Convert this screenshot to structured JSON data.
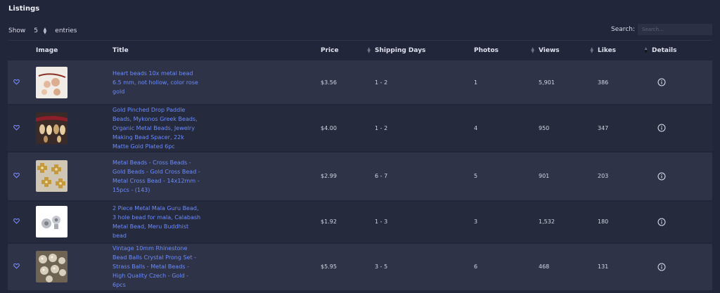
{
  "header": {
    "title": "Listings"
  },
  "length_control": {
    "show_label": "Show",
    "value": "5",
    "entries_label": "entries"
  },
  "search": {
    "label": "Search:",
    "placeholder": "Search..."
  },
  "columns": {
    "image": "Image",
    "title": "Title",
    "price": "Price",
    "shipping": "Shipping Days",
    "photos": "Photos",
    "views": "Views",
    "likes": "Likes",
    "details": "Details"
  },
  "rows": [
    {
      "title": "Heart beads 10x metal bead 6.5 mm, not hollow, color rose gold",
      "price": "$3.56",
      "shipping": "1 - 2",
      "photos": "1",
      "views": "5,901",
      "likes": "386",
      "thumb": "heart-beads-photo"
    },
    {
      "title": "Gold Pinched Drop Paddle Beads, Mykonos Greek Beads, Organic Metal Beads, Jewelry Making Bead Spacer, 22k Matte Gold Plated 6pc",
      "price": "$4.00",
      "shipping": "1 - 2",
      "photos": "4",
      "views": "950",
      "likes": "347",
      "thumb": "paddle-beads-photo"
    },
    {
      "title": "Metal Beads - Cross Beads - Gold Beads - Gold Cross Bead - Metal Cross Bead - 14x12mm - 15pcs - (143)",
      "price": "$2.99",
      "shipping": "6 - 7",
      "photos": "5",
      "views": "901",
      "likes": "203",
      "thumb": "cross-beads-photo"
    },
    {
      "title": "2 Piece Metal Mala Guru Bead, 3 hole bead for mala, Calabash Metal Bead, Meru Buddhist bead",
      "price": "$1.92",
      "shipping": "1 - 3",
      "photos": "3",
      "views": "1,532",
      "likes": "180",
      "thumb": "guru-bead-photo"
    },
    {
      "title": "Vintage 10mm Rhinestone Bead Balls Crystal Prong Set - Strass Balls - Metal Beads - High Quality Czech - Gold - 6pcs",
      "price": "$5.95",
      "shipping": "3 - 5",
      "photos": "6",
      "views": "468",
      "likes": "131",
      "thumb": "rhinestone-balls-photo"
    }
  ],
  "colors": {
    "background": "#22263a",
    "row_odd": "#2e3347",
    "row_even": "#262a3d",
    "link": "#6b8cff",
    "heart": "#7b8cff"
  }
}
